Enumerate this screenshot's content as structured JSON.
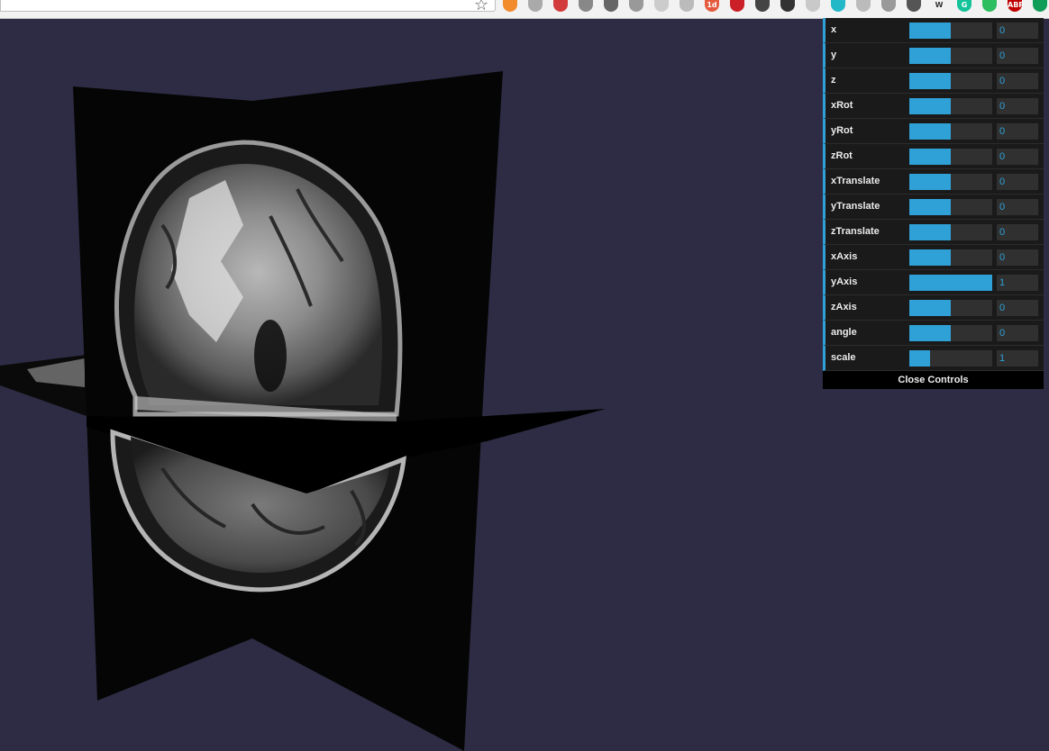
{
  "browser": {
    "bookmark_icon": "star-icon",
    "extensions": [
      {
        "name": "extension-icon-1",
        "color": "#f28b2b",
        "glyph": ""
      },
      {
        "name": "extension-icon-2",
        "color": "#aaaaaa",
        "glyph": ""
      },
      {
        "name": "extension-icon-3",
        "color": "#d23c3c",
        "glyph": ""
      },
      {
        "name": "extension-icon-4",
        "color": "#888888",
        "glyph": ""
      },
      {
        "name": "extension-icon-5",
        "color": "#666666",
        "glyph": ""
      },
      {
        "name": "extension-icon-6",
        "color": "#999999",
        "glyph": ""
      },
      {
        "name": "extension-icon-7",
        "color": "#cccccc",
        "glyph": ""
      },
      {
        "name": "extension-icon-8",
        "color": "#bbbbbb",
        "glyph": ""
      },
      {
        "name": "extension-icon-9",
        "color": "#e45a3c",
        "glyph": "1d"
      },
      {
        "name": "extension-icon-10",
        "color": "#cb2027",
        "glyph": ""
      },
      {
        "name": "extension-icon-11",
        "color": "#444444",
        "glyph": ""
      },
      {
        "name": "extension-icon-12",
        "color": "#333333",
        "glyph": ""
      },
      {
        "name": "extension-icon-13",
        "color": "#c9c9c9",
        "glyph": ""
      },
      {
        "name": "extension-icon-14",
        "color": "#22b8c8",
        "glyph": ""
      },
      {
        "name": "extension-icon-15",
        "color": "#bbbbbb",
        "glyph": ""
      },
      {
        "name": "extension-icon-16",
        "color": "#999999",
        "glyph": ""
      },
      {
        "name": "extension-icon-17",
        "color": "#555555",
        "glyph": ""
      },
      {
        "name": "extension-icon-18",
        "color": "#f2f2f2",
        "glyph": "W"
      },
      {
        "name": "extension-icon-19",
        "color": "#15c39a",
        "glyph": "G"
      },
      {
        "name": "extension-icon-20",
        "color": "#2dbe60",
        "glyph": ""
      },
      {
        "name": "extension-icon-21",
        "color": "#c00000",
        "glyph": "ABP"
      },
      {
        "name": "extension-icon-22",
        "color": "#0f9d58",
        "glyph": ""
      }
    ]
  },
  "scene": {
    "background": "#2d2c44"
  },
  "gui": {
    "accent": "#2fa1d6",
    "controls": [
      {
        "label": "x",
        "value": "0",
        "fill": 0.5
      },
      {
        "label": "y",
        "value": "0",
        "fill": 0.5
      },
      {
        "label": "z",
        "value": "0",
        "fill": 0.5
      },
      {
        "label": "xRot",
        "value": "0",
        "fill": 0.5
      },
      {
        "label": "yRot",
        "value": "0",
        "fill": 0.5
      },
      {
        "label": "zRot",
        "value": "0",
        "fill": 0.5
      },
      {
        "label": "xTranslate",
        "value": "0",
        "fill": 0.5
      },
      {
        "label": "yTranslate",
        "value": "0",
        "fill": 0.5
      },
      {
        "label": "zTranslate",
        "value": "0",
        "fill": 0.5
      },
      {
        "label": "xAxis",
        "value": "0",
        "fill": 0.5
      },
      {
        "label": "yAxis",
        "value": "1",
        "fill": 1.0
      },
      {
        "label": "zAxis",
        "value": "0",
        "fill": 0.5
      },
      {
        "label": "angle",
        "value": "0",
        "fill": 0.5
      },
      {
        "label": "scale",
        "value": "1",
        "fill": 0.25
      }
    ],
    "close_label": "Close Controls"
  }
}
